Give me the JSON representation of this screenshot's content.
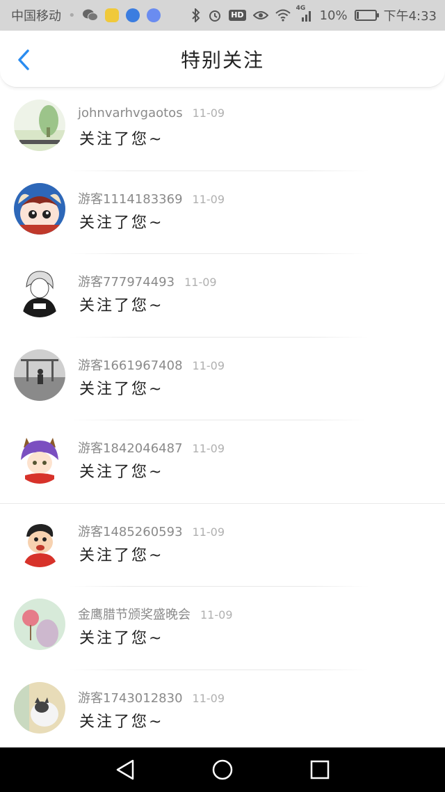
{
  "status_bar": {
    "carrier": "中国移动",
    "network": "4G",
    "battery": "10%",
    "battery_level": 0.1,
    "time": "下午4:33",
    "hd": "HD"
  },
  "header": {
    "title": "特别关注"
  },
  "notifications": [
    {
      "username": "johnvarhvgaotos",
      "date": "11-09",
      "message": "关注了您~"
    },
    {
      "username": "游客1114183369",
      "date": "11-09",
      "message": "关注了您~"
    },
    {
      "username": "游客777974493",
      "date": "11-09",
      "message": "关注了您~"
    },
    {
      "username": "游客1661967408",
      "date": "11-09",
      "message": "关注了您~"
    },
    {
      "username": "游客1842046487",
      "date": "11-09",
      "message": "关注了您~"
    },
    {
      "username": "游客1485260593",
      "date": "11-09",
      "message": "关注了您~"
    },
    {
      "username": "金鹰腊节颁奖盛晚会",
      "date": "11-09",
      "message": "关注了您~"
    },
    {
      "username": "游客1743012830",
      "date": "11-09",
      "message": "关注了您~"
    }
  ],
  "colors": {
    "accent": "#2a8cf0",
    "status_bar_bg": "#d6d6d6",
    "nav_bar_bg": "#000000"
  }
}
